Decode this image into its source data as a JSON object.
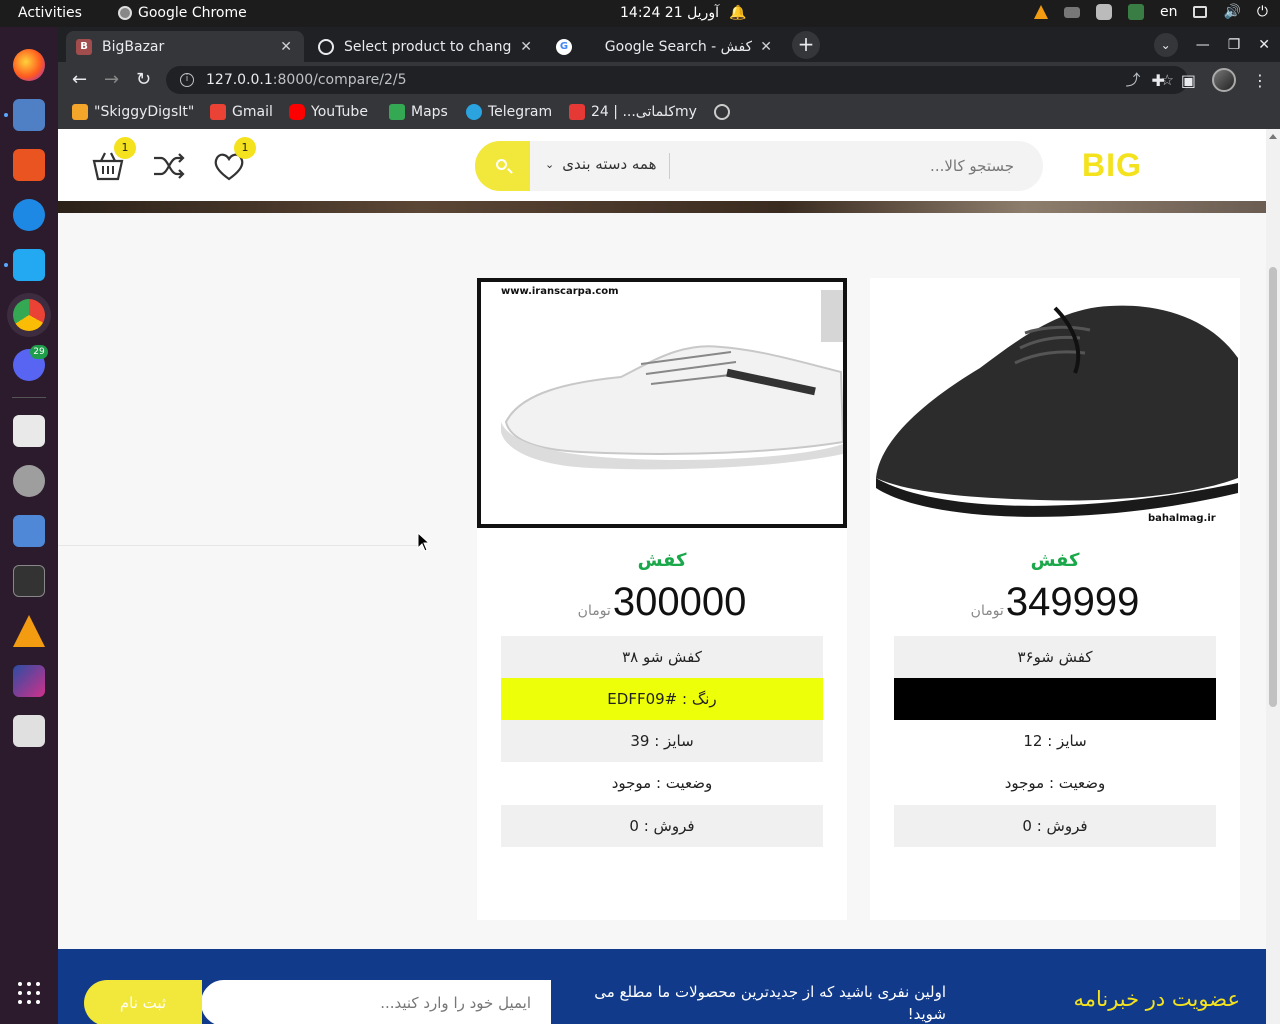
{
  "system": {
    "activities": "Activities",
    "app_name": "Google Chrome",
    "clock": "14:24  21 آوریل",
    "lang": "en"
  },
  "browser": {
    "tabs": [
      {
        "label": "BigBazar",
        "favicon": "B"
      },
      {
        "label": "Select product to change",
        "favicon": "globe-icon"
      },
      {
        "label": "Google Search - کفش",
        "favicon": "G"
      }
    ],
    "url_host": "127.0.0.1",
    "url_path": ":8000/compare/2/5",
    "bookmarks": [
      {
        "label": "\"SkiggyDigsIt\"",
        "color": "#f4a62a"
      },
      {
        "label": "Gmail",
        "color": "#ea4335"
      },
      {
        "label": "YouTube",
        "color": "#ff0000"
      },
      {
        "label": "Maps",
        "color": "#34a853"
      },
      {
        "label": "Telegram",
        "color": "#2aa3df"
      },
      {
        "label": "کلماتی... | 24my",
        "color": "#e53935"
      }
    ]
  },
  "dock": {
    "discord_badge": "29"
  },
  "site": {
    "logo": "BIG",
    "search_placeholder": "جستجو کالا...",
    "category_label": "همه دسته بندی",
    "compare_count": "1",
    "cart_count": "1",
    "accent": "#f3e21d"
  },
  "products": [
    {
      "name": "کفش",
      "price": "349999",
      "currency": "تومان",
      "title": "کفش شو۳۶",
      "color_row": "",
      "color_hex": "#000000",
      "size": "سایز : 12",
      "status": "وضعیت : موجود",
      "sales": "فروش : 0",
      "watermark": "bahalmag.ir"
    },
    {
      "name": "کفش",
      "price": "300000",
      "currency": "تومان",
      "title": "کفش شو ۳۸",
      "color_row": "رنگ : #EDFF09",
      "color_hex": "#edff09",
      "size": "سایز : 39",
      "status": "وضعیت : موجود",
      "sales": "فروش : 0",
      "watermark": "www.iranscarpa.com"
    }
  ],
  "newsletter": {
    "title": "عضویت در خبرنامه",
    "text": "اولین نفری باشید که از جدیدترین محصولات ما مطلع می شوید!",
    "placeholder": "ایمیل خود را وارد کنید...",
    "button": "ثبت نام",
    "bg": "#113a8b"
  }
}
